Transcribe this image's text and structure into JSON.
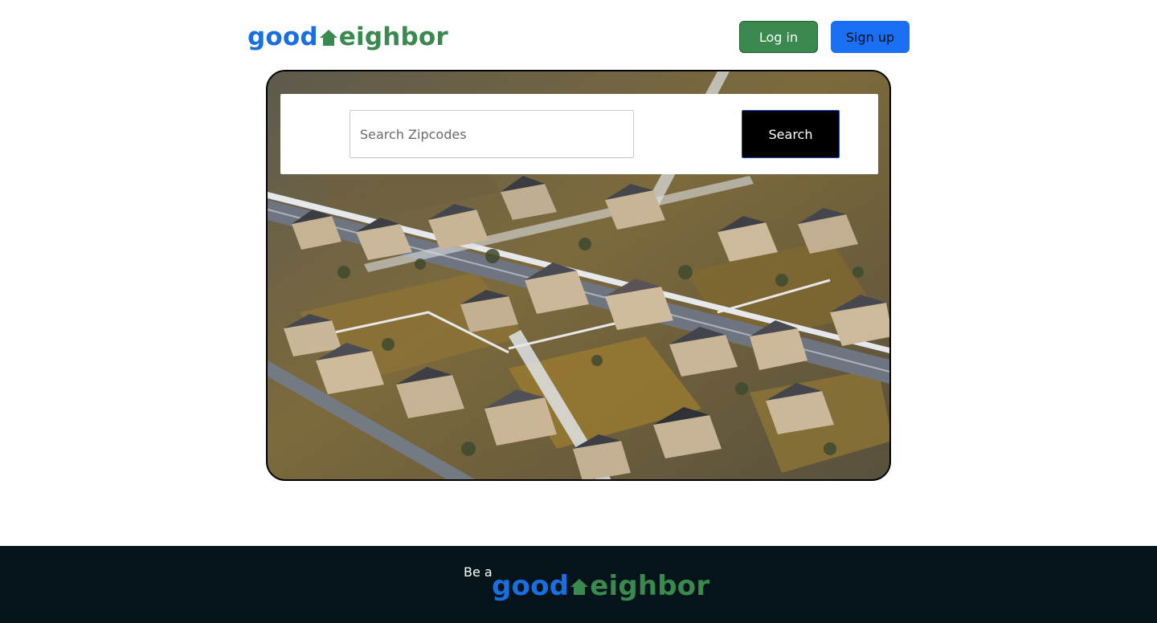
{
  "header": {
    "logo": {
      "part1": "good",
      "part2": "eighbor",
      "icon": "house-icon"
    },
    "login_label": "Log in",
    "signup_label": "Sign up"
  },
  "hero": {
    "image": "aerial-suburban-neighborhood-photo",
    "search": {
      "placeholder": "Search Zipcodes",
      "value": "",
      "button_label": "Search"
    }
  },
  "footer": {
    "tagline": "Be a",
    "logo": {
      "part1": "good",
      "part2": "eighbor",
      "icon": "house-icon"
    }
  },
  "colors": {
    "brand_blue": "#1a6fe0",
    "brand_green": "#3a8a4f",
    "login_bg": "#3a8a4f",
    "signup_bg": "#1a6ff2",
    "search_button_bg": "#000000",
    "footer_bg": "#04141a"
  }
}
